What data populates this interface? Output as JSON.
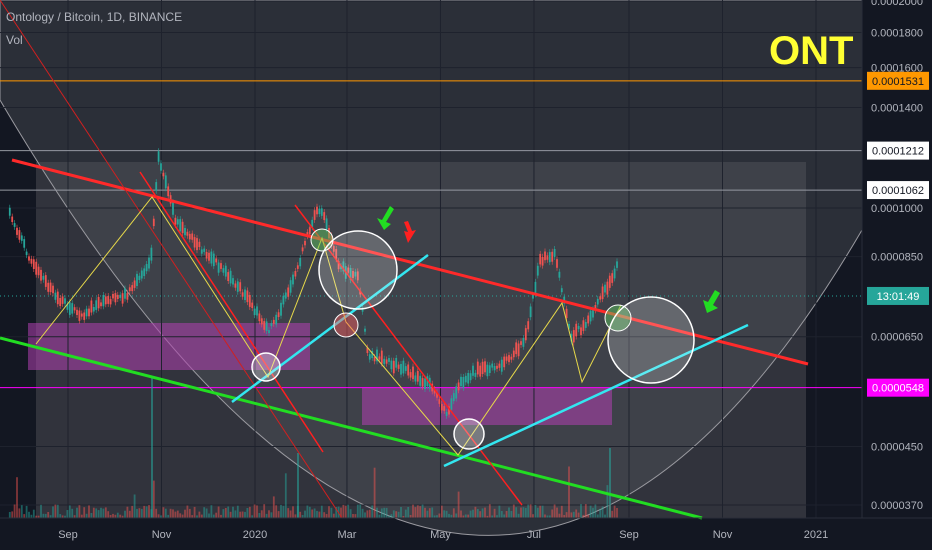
{
  "header": {
    "symbol_line": "Ontology / Bitcoin, 1D, BINANCE",
    "volume_label": "Vol"
  },
  "watermark_ticker": "ONT",
  "colors": {
    "background": "#131722",
    "axis_text": "#b2b5be",
    "resistance_line": "#ff2a2a",
    "support_line": "#22dd22",
    "cyan_line": "#33e6f0",
    "orange_level": "#ff9800",
    "magenta_level": "#ff00ff",
    "consolidation_box": "#b03fb0",
    "ticker": "#ffff33"
  },
  "chart_data": {
    "type": "line",
    "title": "Ontology / Bitcoin, 1D, BINANCE",
    "xlabel": "",
    "ylabel": "",
    "y_scale": "log",
    "ylim": [
      3.5e-05,
      0.0002
    ],
    "x_ticks": [
      "Sep",
      "Nov",
      "2020",
      "Mar",
      "May",
      "Jul",
      "Sep",
      "Nov",
      "2021"
    ],
    "y_ticks": [
      "0.0002000",
      "0.0001800",
      "0.0001600",
      "0.0001400",
      "0.0001000",
      "0.0000850",
      "0.0000650",
      "0.0000450",
      "0.0000370"
    ],
    "price_tags": [
      {
        "label": "0.0001531",
        "value": 0.0001531,
        "style": "orange"
      },
      {
        "label": "0.0001212",
        "value": 0.0001212,
        "style": "white"
      },
      {
        "label": "0.0001062",
        "value": 0.0001062,
        "style": "white"
      },
      {
        "label": "13:01:49",
        "value": 7.45e-05,
        "style": "teal"
      },
      {
        "label": "0.0000548",
        "value": 5.48e-05,
        "style": "magenta"
      }
    ],
    "horizontal_levels": [
      {
        "value": 0.0001531,
        "color": "#ff9800"
      },
      {
        "value": 0.0001212,
        "color": "#9598a1"
      },
      {
        "value": 0.0001062,
        "color": "#9598a1"
      },
      {
        "value": 5.48e-05,
        "color": "#ff00ff"
      }
    ],
    "series": [
      {
        "x": [
          "2019-07-25",
          "2019-08-10",
          "2019-08-25",
          "2019-09-10",
          "2019-09-25",
          "2019-10-10",
          "2019-10-25",
          "2019-10-30",
          "2019-11-10",
          "2019-11-25",
          "2019-12-10",
          "2019-12-25",
          "2020-01-10",
          "2020-01-25",
          "2020-02-10",
          "2020-02-15",
          "2020-02-25",
          "2020-03-08",
          "2020-03-15",
          "2020-03-25",
          "2020-04-10",
          "2020-04-25",
          "2020-05-05",
          "2020-05-15",
          "2020-05-25",
          "2020-06-10",
          "2020-06-25",
          "2020-07-05",
          "2020-07-15",
          "2020-07-25",
          "2020-08-05",
          "2020-08-15",
          "2020-08-25"
        ],
        "values": [
          9.8e-05,
          8.2e-05,
          7.4e-05,
          7e-05,
          7.3e-05,
          7.5e-05,
          8.4e-05,
          0.000119,
          9.6e-05,
          8.8e-05,
          8.2e-05,
          7.5e-05,
          6.6e-05,
          7.7e-05,
          0.0001,
          9.7e-05,
          8.2e-05,
          8e-05,
          6.1e-05,
          6e-05,
          5.8e-05,
          5.5e-05,
          5e-05,
          5.6e-05,
          5.8e-05,
          5.9e-05,
          6.4e-05,
          8.4e-05,
          8.6e-05,
          6.5e-05,
          6.8e-05,
          7.5e-05,
          8.3e-05
        ]
      }
    ]
  }
}
